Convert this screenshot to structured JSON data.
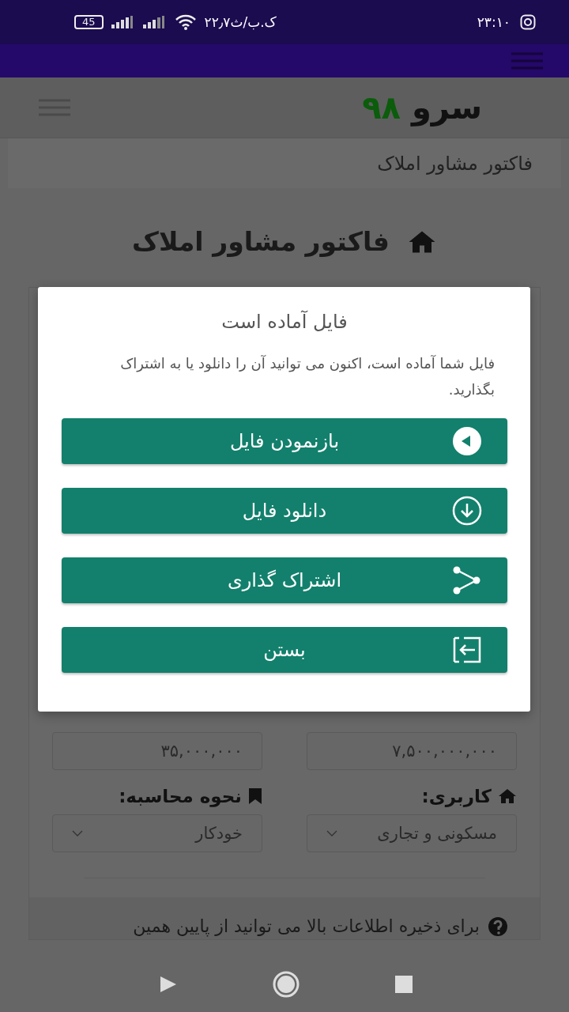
{
  "status_bar": {
    "time": "۲۳:۱۰",
    "speed": "۲۲٫۷ک.ب/ث",
    "battery": "45"
  },
  "header": {
    "logo_word": "سرو",
    "logo_number": "۹۸"
  },
  "breadcrumb": "فاکتور مشاور املاک",
  "page_title": "فاکتور مشاور املاک",
  "form": {
    "amounts": [
      {
        "value": "۷,۵۰۰,۰۰۰,۰۰۰"
      },
      {
        "value": "۳۵,۰۰۰,۰۰۰"
      }
    ],
    "selects": [
      {
        "label": "کاربری:",
        "value": "مسکونی و تجاری",
        "kind": "home"
      },
      {
        "label": "نحوه محاسبه:",
        "value": "خودکار",
        "kind": "bookmark"
      }
    ],
    "hint": "برای ذخیره اطلاعات بالا می توانید از پایین همین"
  },
  "dialog": {
    "title": "فایل آماده است",
    "message": "فایل شما آماده است، اکنون می توانید آن را دانلود یا به اشتراک بگذارید.",
    "buttons": [
      {
        "label": "بازنمودن فایل",
        "kind": "open"
      },
      {
        "label": "دانلود فایل",
        "kind": "download"
      },
      {
        "label": "اشتراک گذاری",
        "kind": "share"
      },
      {
        "label": "بستن",
        "kind": "close"
      }
    ]
  }
}
